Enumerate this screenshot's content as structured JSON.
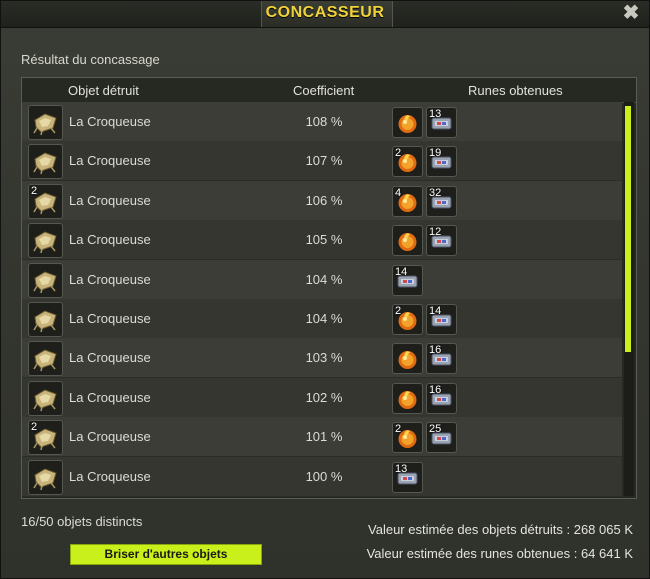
{
  "window": {
    "title": "CONCASSEUR",
    "close_label": "✖"
  },
  "subtitle": "Résultat du concassage",
  "columns": {
    "object": "Objet détruit",
    "coefficient": "Coefficient",
    "runes": "Runes obtenues"
  },
  "rows": [
    {
      "item_qty": "",
      "name": "La Croqueuse",
      "coef": "108 %",
      "runes": [
        {
          "type": "fire",
          "qty": ""
        },
        {
          "type": "stat",
          "qty": "13"
        }
      ]
    },
    {
      "item_qty": "",
      "name": "La Croqueuse",
      "coef": "107 %",
      "runes": [
        {
          "type": "fire",
          "qty": "2"
        },
        {
          "type": "stat",
          "qty": "19"
        }
      ]
    },
    {
      "item_qty": "2",
      "name": "La Croqueuse",
      "coef": "106 %",
      "runes": [
        {
          "type": "fire",
          "qty": "4"
        },
        {
          "type": "stat",
          "qty": "32"
        }
      ]
    },
    {
      "item_qty": "",
      "name": "La Croqueuse",
      "coef": "105 %",
      "runes": [
        {
          "type": "fire",
          "qty": ""
        },
        {
          "type": "stat",
          "qty": "12"
        }
      ]
    },
    {
      "item_qty": "",
      "name": "La Croqueuse",
      "coef": "104 %",
      "runes": [
        {
          "type": "stat",
          "qty": "14"
        }
      ]
    },
    {
      "item_qty": "",
      "name": "La Croqueuse",
      "coef": "104 %",
      "runes": [
        {
          "type": "fire",
          "qty": "2"
        },
        {
          "type": "stat",
          "qty": "14"
        }
      ]
    },
    {
      "item_qty": "",
      "name": "La Croqueuse",
      "coef": "103 %",
      "runes": [
        {
          "type": "fire",
          "qty": ""
        },
        {
          "type": "stat",
          "qty": "16"
        }
      ]
    },
    {
      "item_qty": "",
      "name": "La Croqueuse",
      "coef": "102 %",
      "runes": [
        {
          "type": "fire",
          "qty": ""
        },
        {
          "type": "stat",
          "qty": "16"
        }
      ]
    },
    {
      "item_qty": "2",
      "name": "La Croqueuse",
      "coef": "101 %",
      "runes": [
        {
          "type": "fire",
          "qty": "2"
        },
        {
          "type": "stat",
          "qty": "25"
        }
      ]
    },
    {
      "item_qty": "",
      "name": "La Croqueuse",
      "coef": "100 %",
      "runes": [
        {
          "type": "stat",
          "qty": "13"
        }
      ]
    }
  ],
  "footer": {
    "distinct": "16/50 objets distincts",
    "destroyed_value": "Valeur estimée des objets détruits : 268 065 K",
    "runes_value": "Valeur estimée des runes obtenues : 64 641 K",
    "button_label": "Briser d'autres objets"
  },
  "colors": {
    "accent": "#c9f01b",
    "title": "#f0d33a"
  }
}
